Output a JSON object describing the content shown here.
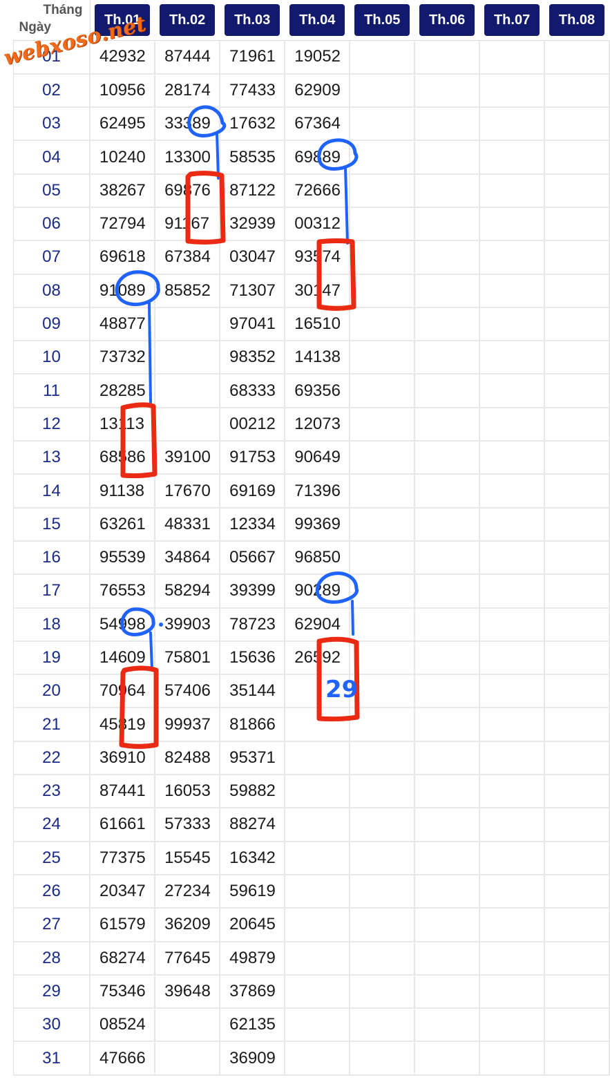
{
  "header": {
    "corner_top": "Tháng",
    "corner_bottom": "Ngày",
    "months": [
      "Th.01",
      "Th.02",
      "Th.03",
      "Th.04",
      "Th.05",
      "Th.06",
      "Th.07",
      "Th.08"
    ]
  },
  "rows": [
    {
      "day": "01",
      "values": [
        "42932",
        "87444",
        "71961",
        "19052",
        "",
        "",
        "",
        ""
      ]
    },
    {
      "day": "02",
      "values": [
        "10956",
        "28174",
        "77433",
        "62909",
        "",
        "",
        "",
        ""
      ]
    },
    {
      "day": "03",
      "values": [
        "62495",
        "33389",
        "17632",
        "67364",
        "",
        "",
        "",
        ""
      ]
    },
    {
      "day": "04",
      "values": [
        "10240",
        "13300",
        "58535",
        "69889",
        "",
        "",
        "",
        ""
      ]
    },
    {
      "day": "05",
      "values": [
        "38267",
        "69876",
        "87122",
        "72666",
        "",
        "",
        "",
        ""
      ]
    },
    {
      "day": "06",
      "values": [
        "72794",
        "91167",
        "32939",
        "00312",
        "",
        "",
        "",
        ""
      ]
    },
    {
      "day": "07",
      "values": [
        "69618",
        "67384",
        "03047",
        "93574",
        "",
        "",
        "",
        ""
      ]
    },
    {
      "day": "08",
      "values": [
        "91089",
        "85852",
        "71307",
        "30147",
        "",
        "",
        "",
        ""
      ]
    },
    {
      "day": "09",
      "values": [
        "48877",
        "",
        "97041",
        "16510",
        "",
        "",
        "",
        ""
      ]
    },
    {
      "day": "10",
      "values": [
        "73732",
        "",
        "98352",
        "14138",
        "",
        "",
        "",
        ""
      ]
    },
    {
      "day": "11",
      "values": [
        "28285",
        "",
        "68333",
        "69356",
        "",
        "",
        "",
        ""
      ]
    },
    {
      "day": "12",
      "values": [
        "13113",
        "",
        "00212",
        "12073",
        "",
        "",
        "",
        ""
      ]
    },
    {
      "day": "13",
      "values": [
        "68586",
        "39100",
        "91753",
        "90649",
        "",
        "",
        "",
        ""
      ]
    },
    {
      "day": "14",
      "values": [
        "91138",
        "17670",
        "69169",
        "71396",
        "",
        "",
        "",
        ""
      ]
    },
    {
      "day": "15",
      "values": [
        "63261",
        "48331",
        "12334",
        "99369",
        "",
        "",
        "",
        ""
      ]
    },
    {
      "day": "16",
      "values": [
        "95539",
        "34864",
        "05667",
        "96850",
        "",
        "",
        "",
        ""
      ]
    },
    {
      "day": "17",
      "values": [
        "76553",
        "58294",
        "39399",
        "90289",
        "",
        "",
        "",
        ""
      ]
    },
    {
      "day": "18",
      "values": [
        "54998",
        "39903",
        "78723",
        "62904",
        "",
        "",
        "",
        ""
      ]
    },
    {
      "day": "19",
      "values": [
        "14609",
        "75801",
        "15636",
        "26592",
        "",
        "",
        "",
        ""
      ]
    },
    {
      "day": "20",
      "values": [
        "70964",
        "57406",
        "35144",
        "",
        "",
        "",
        "",
        ""
      ]
    },
    {
      "day": "21",
      "values": [
        "45819",
        "99937",
        "81866",
        "",
        "",
        "",
        "",
        ""
      ]
    },
    {
      "day": "22",
      "values": [
        "36910",
        "82488",
        "95371",
        "",
        "",
        "",
        "",
        ""
      ]
    },
    {
      "day": "23",
      "values": [
        "87441",
        "16053",
        "59882",
        "",
        "",
        "",
        "",
        ""
      ]
    },
    {
      "day": "24",
      "values": [
        "61661",
        "57333",
        "88274",
        "",
        "",
        "",
        "",
        ""
      ]
    },
    {
      "day": "25",
      "values": [
        "77375",
        "15545",
        "16342",
        "",
        "",
        "",
        "",
        ""
      ]
    },
    {
      "day": "26",
      "values": [
        "20347",
        "27234",
        "59619",
        "",
        "",
        "",
        "",
        ""
      ]
    },
    {
      "day": "27",
      "values": [
        "61579",
        "36209",
        "20645",
        "",
        "",
        "",
        "",
        ""
      ]
    },
    {
      "day": "28",
      "values": [
        "68274",
        "77645",
        "49879",
        "",
        "",
        "",
        "",
        ""
      ]
    },
    {
      "day": "29",
      "values": [
        "75346",
        "39648",
        "37869",
        "",
        "",
        "",
        "",
        ""
      ]
    },
    {
      "day": "30",
      "values": [
        "08524",
        "",
        "62135",
        "",
        "",
        "",
        "",
        ""
      ]
    },
    {
      "day": "31",
      "values": [
        "47666",
        "",
        "36909",
        "",
        "",
        "",
        "",
        ""
      ]
    }
  ],
  "watermark": "webxoso.net",
  "handwritten_note": "29",
  "colors": {
    "header_button": "#121a6e",
    "day_text": "#1a2a88",
    "circle_marker": "#1f63ff",
    "box_marker": "#ea2a12",
    "watermark": "#f26a1b"
  }
}
